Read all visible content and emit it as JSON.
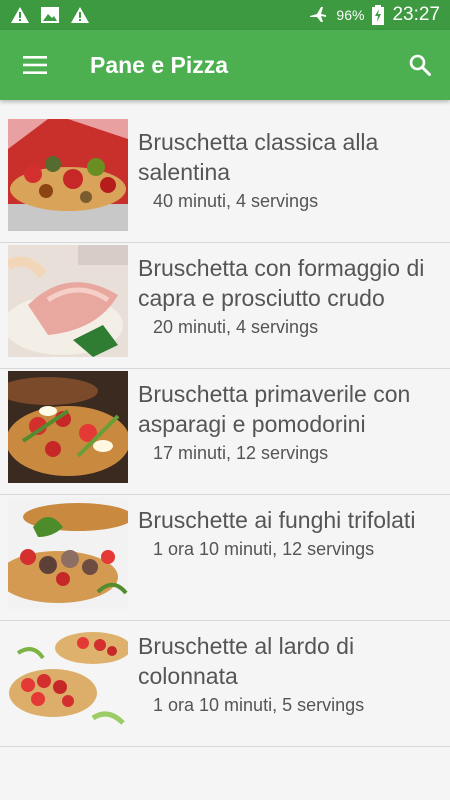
{
  "status": {
    "battery": "96%",
    "time": "23:27"
  },
  "app": {
    "title": "Pane e Pizza"
  },
  "recipes": [
    {
      "title": "Bruschetta classica alla salentina",
      "meta": "40 minuti, 4 servings"
    },
    {
      "title": "Bruschetta con formaggio di capra e prosciutto crudo",
      "meta": "20 minuti, 4 servings"
    },
    {
      "title": "Bruschetta primaverile con asparagi e pomodorini",
      "meta": "17 minuti, 12 servings"
    },
    {
      "title": "Bruschette ai funghi trifolati",
      "meta": "1 ora 10 minuti, 12 servings"
    },
    {
      "title": "Bruschette al lardo di colonnata",
      "meta": "1 ora 10 minuti, 5 servings"
    }
  ],
  "colors": {
    "statusbar": "#3d9a41",
    "appbar": "#4caf50"
  }
}
